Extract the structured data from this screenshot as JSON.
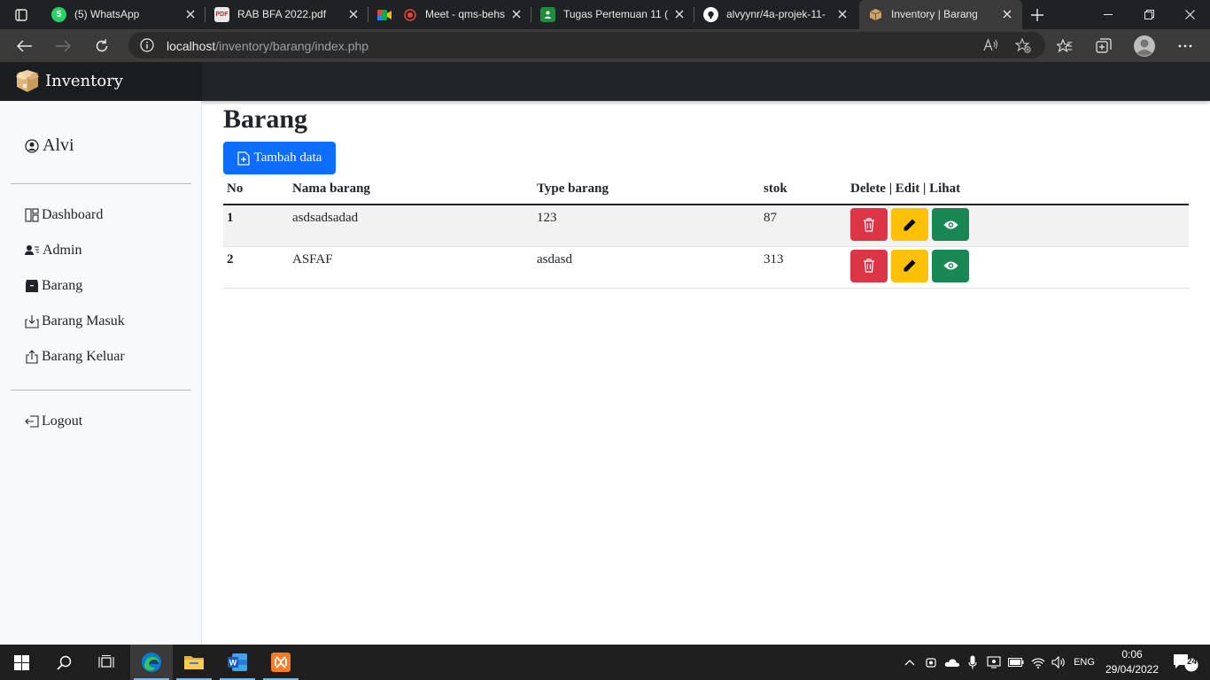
{
  "browser": {
    "tabs": [
      {
        "title": "(5) WhatsApp",
        "favicon": "whatsapp-icon",
        "badge": "5",
        "color": "#25d366"
      },
      {
        "title": "RAB BFA 2022.pdf",
        "favicon": "pdf-icon",
        "badge": "PDF",
        "color": "#e0e0e0"
      },
      {
        "title": "Meet - qms-behs",
        "favicon": "meet-icon",
        "color": "#ea4335"
      },
      {
        "title": "Tugas Pertemuan 11 (",
        "favicon": "classroom-icon",
        "color": "#1e8e3e"
      },
      {
        "title": "alvyynr/4a-projek-11-",
        "favicon": "github-icon",
        "color": "#ffffff"
      },
      {
        "title": "Inventory | Barang",
        "favicon": "box-icon",
        "color": "#c9a36b"
      }
    ],
    "address": {
      "host": "localhost",
      "path": "/inventory/barang/index.php"
    }
  },
  "app": {
    "brand": "Inventory",
    "user": "Alvi",
    "nav": [
      {
        "label": "Dashboard",
        "icon": "dashboard-icon"
      },
      {
        "label": "Admin",
        "icon": "admin-icon"
      },
      {
        "label": "Barang",
        "icon": "box-icon"
      },
      {
        "label": "Barang Masuk",
        "icon": "box-arrow-in-icon"
      },
      {
        "label": "Barang Keluar",
        "icon": "box-arrow-out-icon"
      }
    ],
    "logout": "Logout"
  },
  "main": {
    "title": "Barang",
    "add_button": "Tambah data",
    "table": {
      "headers": [
        "No",
        "Nama barang",
        "Type barang",
        "stok",
        "Delete | Edit | Lihat"
      ],
      "rows": [
        {
          "no": "1",
          "nama": "asdsadsadad",
          "type": "123",
          "stok": "87"
        },
        {
          "no": "2",
          "nama": "ASFAF",
          "type": "asdasd",
          "stok": "313"
        }
      ]
    },
    "colors": {
      "primary": "#0d6efd",
      "danger": "#dc3545",
      "warning": "#ffc107",
      "success": "#198754",
      "navbar": "#212529"
    }
  },
  "taskbar": {
    "lang": "ENG",
    "time": "0:06",
    "date": "29/04/2022",
    "notifications": "24"
  }
}
